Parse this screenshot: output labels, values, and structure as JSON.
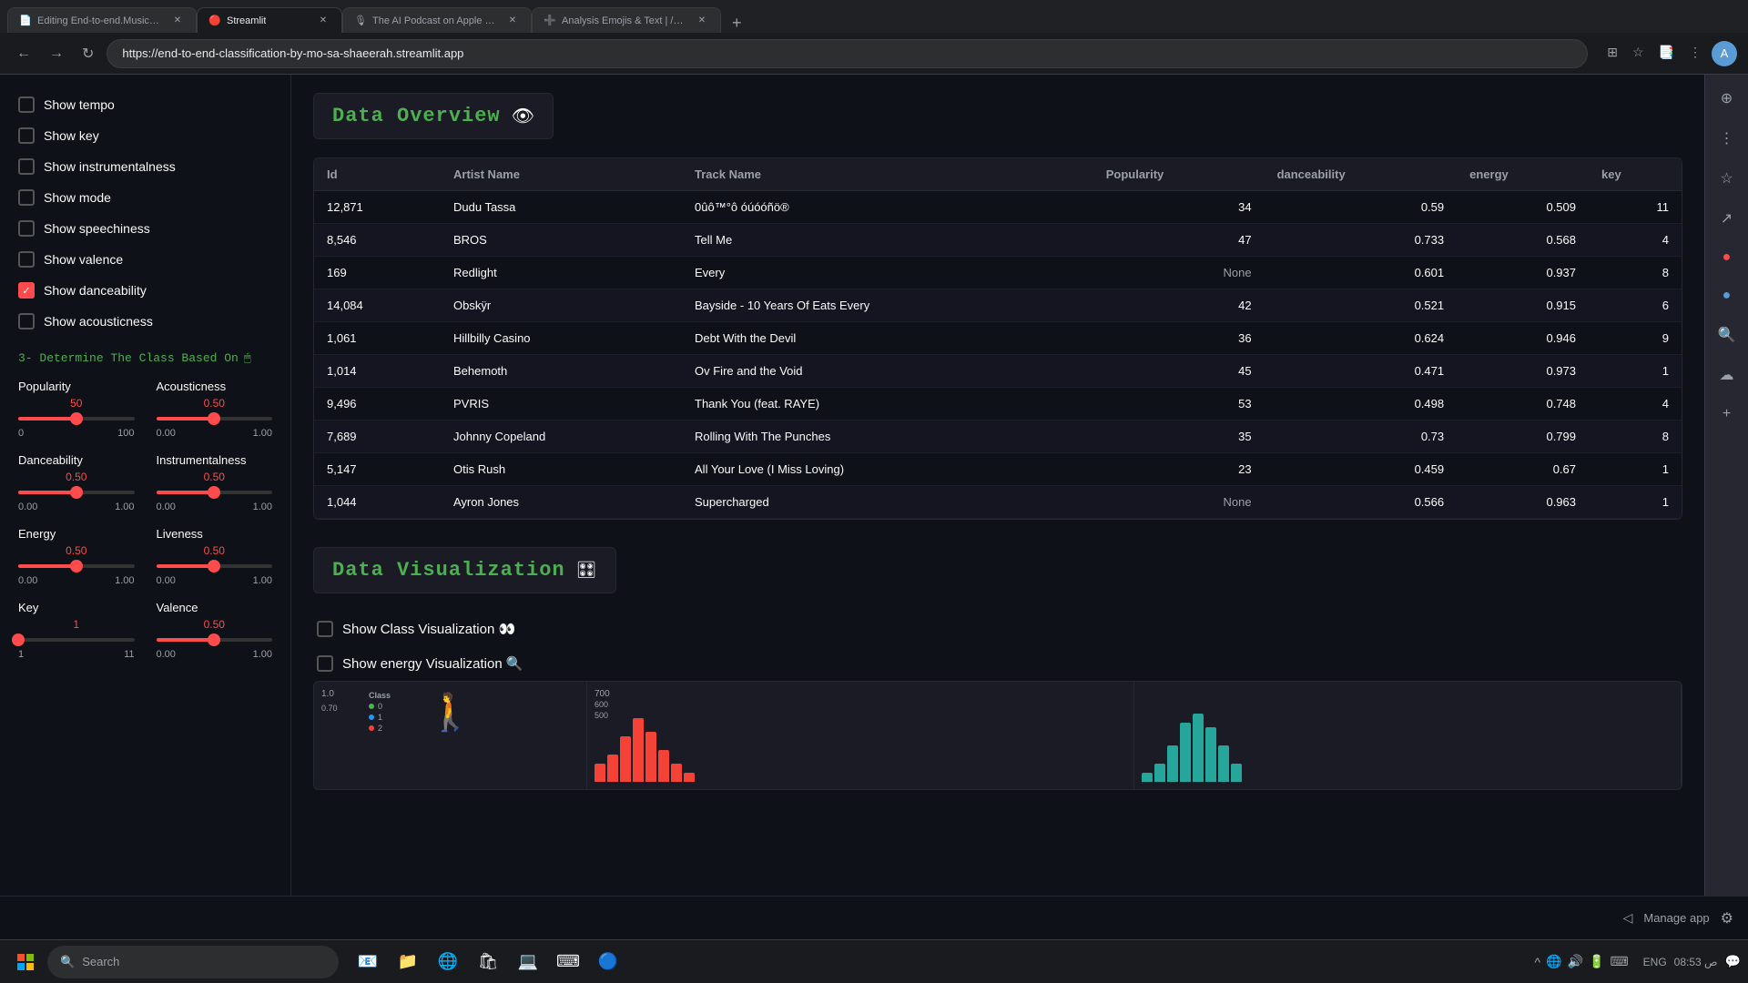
{
  "browser": {
    "tabs": [
      {
        "label": "Editing End-to-end.MusicGen-Cl...",
        "active": false,
        "favicon": "📄"
      },
      {
        "label": "Streamlit",
        "active": true,
        "favicon": "🔴"
      },
      {
        "label": "The AI Podcast on Apple Po...",
        "active": false,
        "favicon": "🎙"
      },
      {
        "label": "Analysis Emojis & Text | /—...",
        "active": false,
        "favicon": "➕"
      }
    ],
    "url": "https://end-to-end-classification-by-mo-sa-shaeerah.streamlit.app"
  },
  "sidebar": {
    "checkboxes": [
      {
        "label": "Show tempo",
        "checked": false
      },
      {
        "label": "Show key",
        "checked": false
      },
      {
        "label": "Show instrumentalness",
        "checked": false
      },
      {
        "label": "Show mode",
        "checked": false
      },
      {
        "label": "Show speechiness",
        "checked": false
      },
      {
        "label": "Show valence",
        "checked": false
      },
      {
        "label": "Show danceability",
        "checked": true
      },
      {
        "label": "Show acousticness",
        "checked": false
      }
    ],
    "section3_label": "3- Determine The Class Based On",
    "sliders": [
      {
        "label": "Popularity",
        "value": "50",
        "min": "0",
        "max": "100",
        "pct": 50
      },
      {
        "label": "Acousticness",
        "value": "0.50",
        "min": "0.00",
        "max": "1.00",
        "pct": 50
      },
      {
        "label": "Danceability",
        "value": "0.50",
        "min": "0.00",
        "max": "1.00",
        "pct": 50
      },
      {
        "label": "Instrumentalness",
        "value": "0.50",
        "min": "0.00",
        "max": "1.00",
        "pct": 50
      },
      {
        "label": "Energy",
        "value": "0.50",
        "min": "0.00",
        "max": "1.00",
        "pct": 50
      },
      {
        "label": "Liveness",
        "value": "0.50",
        "min": "0.00",
        "max": "1.00",
        "pct": 50
      },
      {
        "label": "Key",
        "value": "1",
        "min": "1",
        "max": "11",
        "pct": 0
      },
      {
        "label": "Valence",
        "value": "0.50",
        "min": "0.00",
        "max": "1.00",
        "pct": 50
      }
    ]
  },
  "data_overview": {
    "title": "Data Overview",
    "columns": [
      "Id",
      "Artist Name",
      "Track Name",
      "Popularity",
      "danceability",
      "energy",
      "key"
    ],
    "rows": [
      {
        "id": "12,871",
        "artist": "Dudu Tassa",
        "track": "0ûô™°ô óúóóñö®",
        "popularity": "34",
        "danceability": "0.59",
        "energy": "0.509",
        "key": "11"
      },
      {
        "id": "8,546",
        "artist": "BROS",
        "track": "Tell Me",
        "popularity": "47",
        "danceability": "0.733",
        "energy": "0.568",
        "key": "4"
      },
      {
        "id": "169",
        "artist": "Redlight",
        "track": "Every",
        "popularity": "None",
        "danceability": "0.601",
        "energy": "0.937",
        "key": "8"
      },
      {
        "id": "14,084",
        "artist": "Obskÿr",
        "track": "Bayside - 10 Years Of Eats Every",
        "popularity": "42",
        "danceability": "0.521",
        "energy": "0.915",
        "key": "6"
      },
      {
        "id": "1,061",
        "artist": "Hillbilly Casino",
        "track": "Debt With the Devil",
        "popularity": "36",
        "danceability": "0.624",
        "energy": "0.946",
        "key": "9"
      },
      {
        "id": "1,014",
        "artist": "Behemoth",
        "track": "Ov Fire and the Void",
        "popularity": "45",
        "danceability": "0.471",
        "energy": "0.973",
        "key": "1"
      },
      {
        "id": "9,496",
        "artist": "PVRIS",
        "track": "Thank You (feat. RAYE)",
        "popularity": "53",
        "danceability": "0.498",
        "energy": "0.748",
        "key": "4"
      },
      {
        "id": "7,689",
        "artist": "Johnny Copeland",
        "track": "Rolling With The Punches",
        "popularity": "35",
        "danceability": "0.73",
        "energy": "0.799",
        "key": "8"
      },
      {
        "id": "5,147",
        "artist": "Otis Rush",
        "track": "All Your Love (I Miss Loving)",
        "popularity": "23",
        "danceability": "0.459",
        "energy": "0.67",
        "key": "1"
      },
      {
        "id": "1,044",
        "artist": "Ayron Jones",
        "track": "Supercharged",
        "popularity": "None",
        "danceability": "0.566",
        "energy": "0.963",
        "key": "1"
      }
    ]
  },
  "data_visualization": {
    "title": "Data Visualization",
    "toggle_icon": "🎛",
    "checkboxes": [
      {
        "label": "Show Class Visualization 👀",
        "checked": false
      },
      {
        "label": "Show energy Visualization 🔍",
        "checked": false
      }
    ]
  },
  "manage_bar": {
    "label": "Manage app",
    "settings_icon": "⚙"
  },
  "taskbar": {
    "search_placeholder": "Search",
    "time": "08:53 ص",
    "lang": "ENG"
  }
}
